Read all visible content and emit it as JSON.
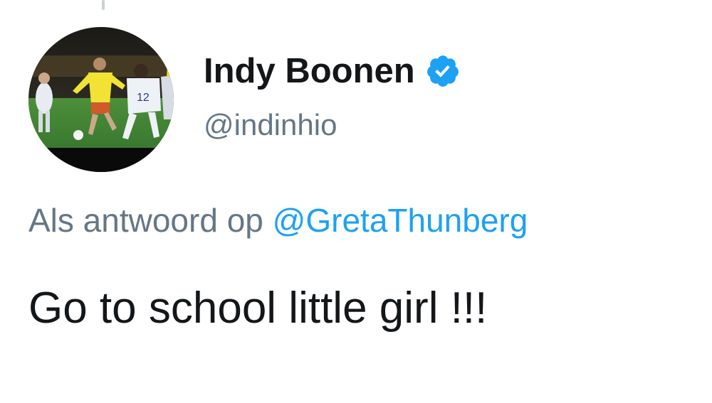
{
  "author": {
    "display_name": "Indy Boonen",
    "handle": "@indinhio",
    "verified": true,
    "avatar_icon": "profile-photo-football-match"
  },
  "reply": {
    "prefix": "Als antwoord op",
    "mention": "@GretaThunberg"
  },
  "tweet": {
    "text": "Go to school little girl !!!"
  },
  "colors": {
    "name": "#14171a",
    "secondary": "#657786",
    "link": "#1da1f2",
    "verified_badge": "#1da1f2"
  }
}
